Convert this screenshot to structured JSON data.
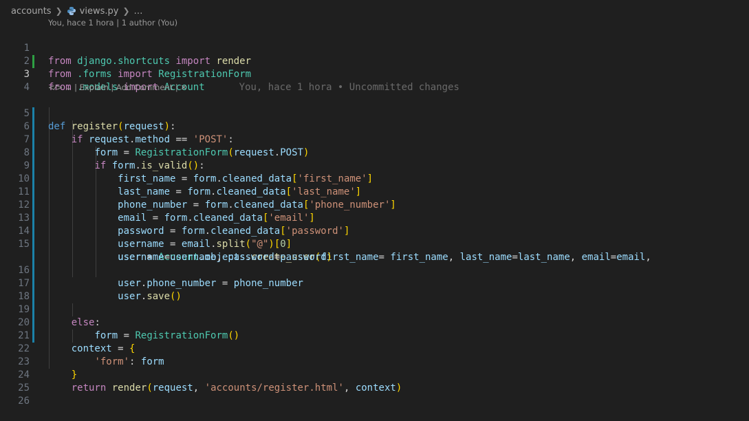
{
  "breadcrumb": {
    "folder": "accounts",
    "file": "views.py",
    "ellipsis": "…"
  },
  "blame": "You, hace 1 hora | 1 author (You)",
  "ghost_text": "You, hace 1 hora • Uncommitted changes",
  "codelens": "<⁄> ⌄ | Explain | Add Comment | ✕",
  "line_numbers": [
    "1",
    "2",
    "3",
    "4",
    "5",
    "6",
    "7",
    "8",
    "9",
    "10",
    "11",
    "12",
    "13",
    "14",
    "15",
    "16",
    "17",
    "18",
    "19",
    "20",
    "21",
    "22",
    "23",
    "24",
    "25",
    "26"
  ],
  "colors": {
    "background": "#1f1f1f",
    "added_marker": "#2ea043",
    "modified_marker": "#1b81a8"
  }
}
